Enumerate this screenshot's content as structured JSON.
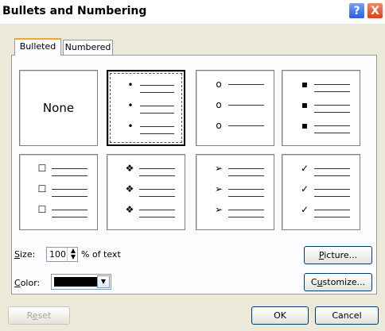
{
  "window": {
    "title": "Bullets and Numbering",
    "help_label": "?",
    "close_label": "X"
  },
  "tabs": [
    {
      "label": "Bulleted",
      "selected": true
    },
    {
      "label": "Numbered",
      "selected": false
    }
  ],
  "grid": {
    "none_label": "None",
    "cells": [
      {
        "id": "none",
        "glyph": ""
      },
      {
        "id": "dot",
        "glyph": "•",
        "selected": true
      },
      {
        "id": "circle",
        "glyph": "o"
      },
      {
        "id": "square",
        "glyph": "▪"
      },
      {
        "id": "hollow-square",
        "glyph": "☐"
      },
      {
        "id": "diamond-dots",
        "glyph": "❖"
      },
      {
        "id": "arrow",
        "glyph": "➢"
      },
      {
        "id": "check",
        "glyph": "✓"
      }
    ]
  },
  "size": {
    "label_prefix": "S",
    "label_rest": "ize:",
    "value": "100",
    "suffix": "% of text",
    "spin_icon": "up-down-arrow-icon"
  },
  "color": {
    "label_prefix": "C",
    "label_rest": "olor:",
    "value": "#000000",
    "dropdown_icon": "chevron-down-icon"
  },
  "buttons": {
    "picture_u": "P",
    "picture_rest": "icture...",
    "customize_a": "C",
    "customize_u": "u",
    "customize_rest": "stomize...",
    "reset_a": "R",
    "reset_u": "e",
    "reset_rest": "set",
    "ok": "OK",
    "cancel": "Cancel"
  }
}
